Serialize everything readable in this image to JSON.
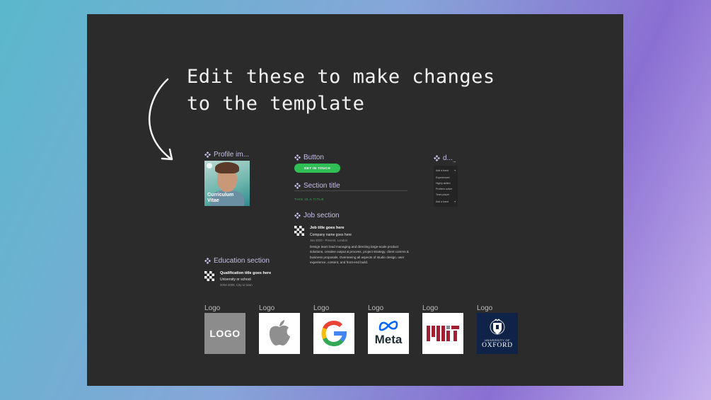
{
  "headline": "Edit these to make changes\nto the template",
  "components": {
    "profile": {
      "title": "Profile im...",
      "card_text": "Curriculum Vitae"
    },
    "button": {
      "title": "Button",
      "label": "GET IN TOUCH"
    },
    "section": {
      "title": "Section title",
      "sample": "THIS IS A TITLE"
    },
    "job": {
      "title": "Job section",
      "job_title": "Job title goes here",
      "company": "Company name goes here",
      "meta": "Jan 2020 - Present, London",
      "description": "Design team lead managing and directing large-scale product solutions, creative output & process, project strategy, client comms & business proposals. Overseeing all aspects of studio design, user experience, content, and front-end build."
    },
    "education": {
      "title": "Education section",
      "qualification": "Qualification title goes here",
      "school": "University or school",
      "meta": "2004-2008, City or town"
    },
    "dropdown": {
      "title": "d...",
      "dots": "...",
      "items": [
        "Add a band",
        "Experienced",
        "Highly skilled",
        "Problem solver",
        "Team player",
        "Add a band"
      ]
    }
  },
  "logos": [
    {
      "label": "Logo",
      "type": "generic",
      "text": "LOGO"
    },
    {
      "label": "Logo",
      "type": "apple"
    },
    {
      "label": "Logo",
      "type": "google"
    },
    {
      "label": "Logo",
      "type": "meta",
      "text": "Meta"
    },
    {
      "label": "Logo",
      "type": "mit"
    },
    {
      "label": "Logo",
      "type": "oxford",
      "line1": "UNIVERSITY OF",
      "line2": "OXFORD"
    }
  ],
  "colors": {
    "canvas": "#2b2b2b",
    "component_purple": "#c8bde8",
    "accent_green": "#2fbf55",
    "oxford_blue": "#0f2349",
    "mit_red": "#a31f34"
  }
}
